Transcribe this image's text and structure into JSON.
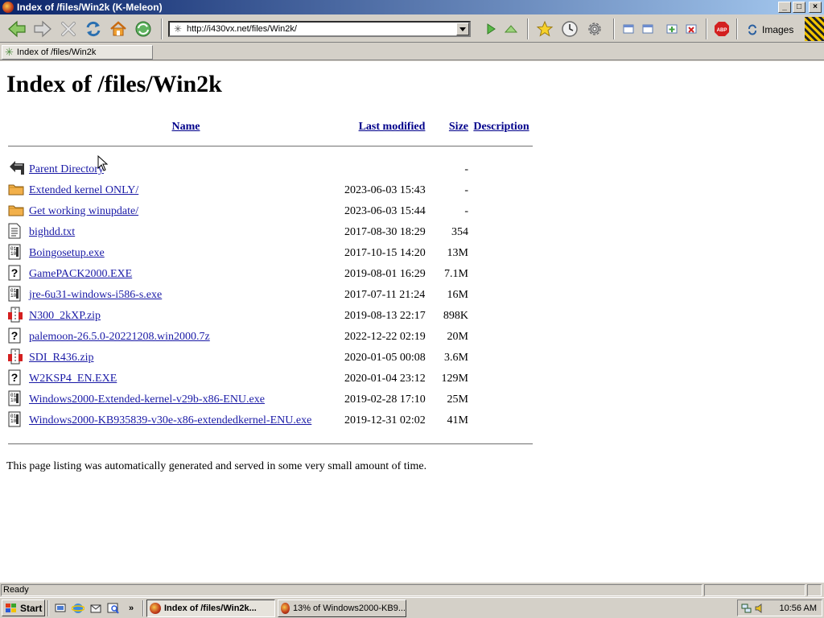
{
  "window": {
    "title": "Index of /files/Win2k (K-Meleon)",
    "buttons": {
      "minimize": "_",
      "maximize": "□",
      "close": "×"
    }
  },
  "toolbar": {
    "url": "http://i430vx.net/files/Win2k/",
    "images_label": "Images",
    "abp_label": "ABP"
  },
  "tab": {
    "label": "Index of /files/Win2k"
  },
  "page": {
    "heading": "Index of /files/Win2k",
    "columns": {
      "name": "Name",
      "modified": "Last modified",
      "size": "Size",
      "description": "Description"
    },
    "rows": [
      {
        "icon": "back",
        "name": "Parent Directory",
        "modified": "",
        "size": "-"
      },
      {
        "icon": "folder",
        "name": "Extended kernel ONLY/",
        "modified": "2023-06-03 15:43",
        "size": "-"
      },
      {
        "icon": "folder",
        "name": "Get working winupdate/",
        "modified": "2023-06-03 15:44",
        "size": "-"
      },
      {
        "icon": "text",
        "name": "bighdd.txt",
        "modified": "2017-08-30 18:29",
        "size": "354"
      },
      {
        "icon": "binary",
        "name": "Boingosetup.exe",
        "modified": "2017-10-15 14:20",
        "size": "13M"
      },
      {
        "icon": "unknown",
        "name": "GamePACK2000.EXE",
        "modified": "2019-08-01 16:29",
        "size": "7.1M"
      },
      {
        "icon": "binary",
        "name": "jre-6u31-windows-i586-s.exe",
        "modified": "2017-07-11 21:24",
        "size": "16M"
      },
      {
        "icon": "compressed",
        "name": "N300_2kXP.zip",
        "modified": "2019-08-13 22:17",
        "size": "898K"
      },
      {
        "icon": "unknown",
        "name": "palemoon-26.5.0-20221208.win2000.7z",
        "modified": "2022-12-22 02:19",
        "size": "20M"
      },
      {
        "icon": "compressed",
        "name": "SDI_R436.zip",
        "modified": "2020-01-05 00:08",
        "size": "3.6M"
      },
      {
        "icon": "unknown",
        "name": "W2KSP4_EN.EXE",
        "modified": "2020-01-04 23:12",
        "size": "129M"
      },
      {
        "icon": "binary",
        "name": "Windows2000-Extended-kernel-v29b-x86-ENU.exe",
        "modified": "2019-02-28 17:10",
        "size": "25M"
      },
      {
        "icon": "binary",
        "name": "Windows2000-KB935839-v30e-x86-extendedkernel-ENU.exe",
        "modified": "2019-12-31 02:02",
        "size": "41M"
      }
    ],
    "footer": "This page listing was automatically generated and served in some very small amount of time."
  },
  "status": {
    "text": "Ready"
  },
  "taskbar": {
    "start_label": "Start",
    "more_label": "»",
    "tasks": [
      {
        "label": "Index of /files/Win2k...",
        "active": true
      },
      {
        "label": "13% of Windows2000-KB9...",
        "active": false
      }
    ],
    "clock": "10:56 AM"
  },
  "colors": {
    "titlebar_start": "#0a246a",
    "titlebar_end": "#a6caf0",
    "chrome": "#d4d0c8",
    "link": "#1a1aa6"
  }
}
